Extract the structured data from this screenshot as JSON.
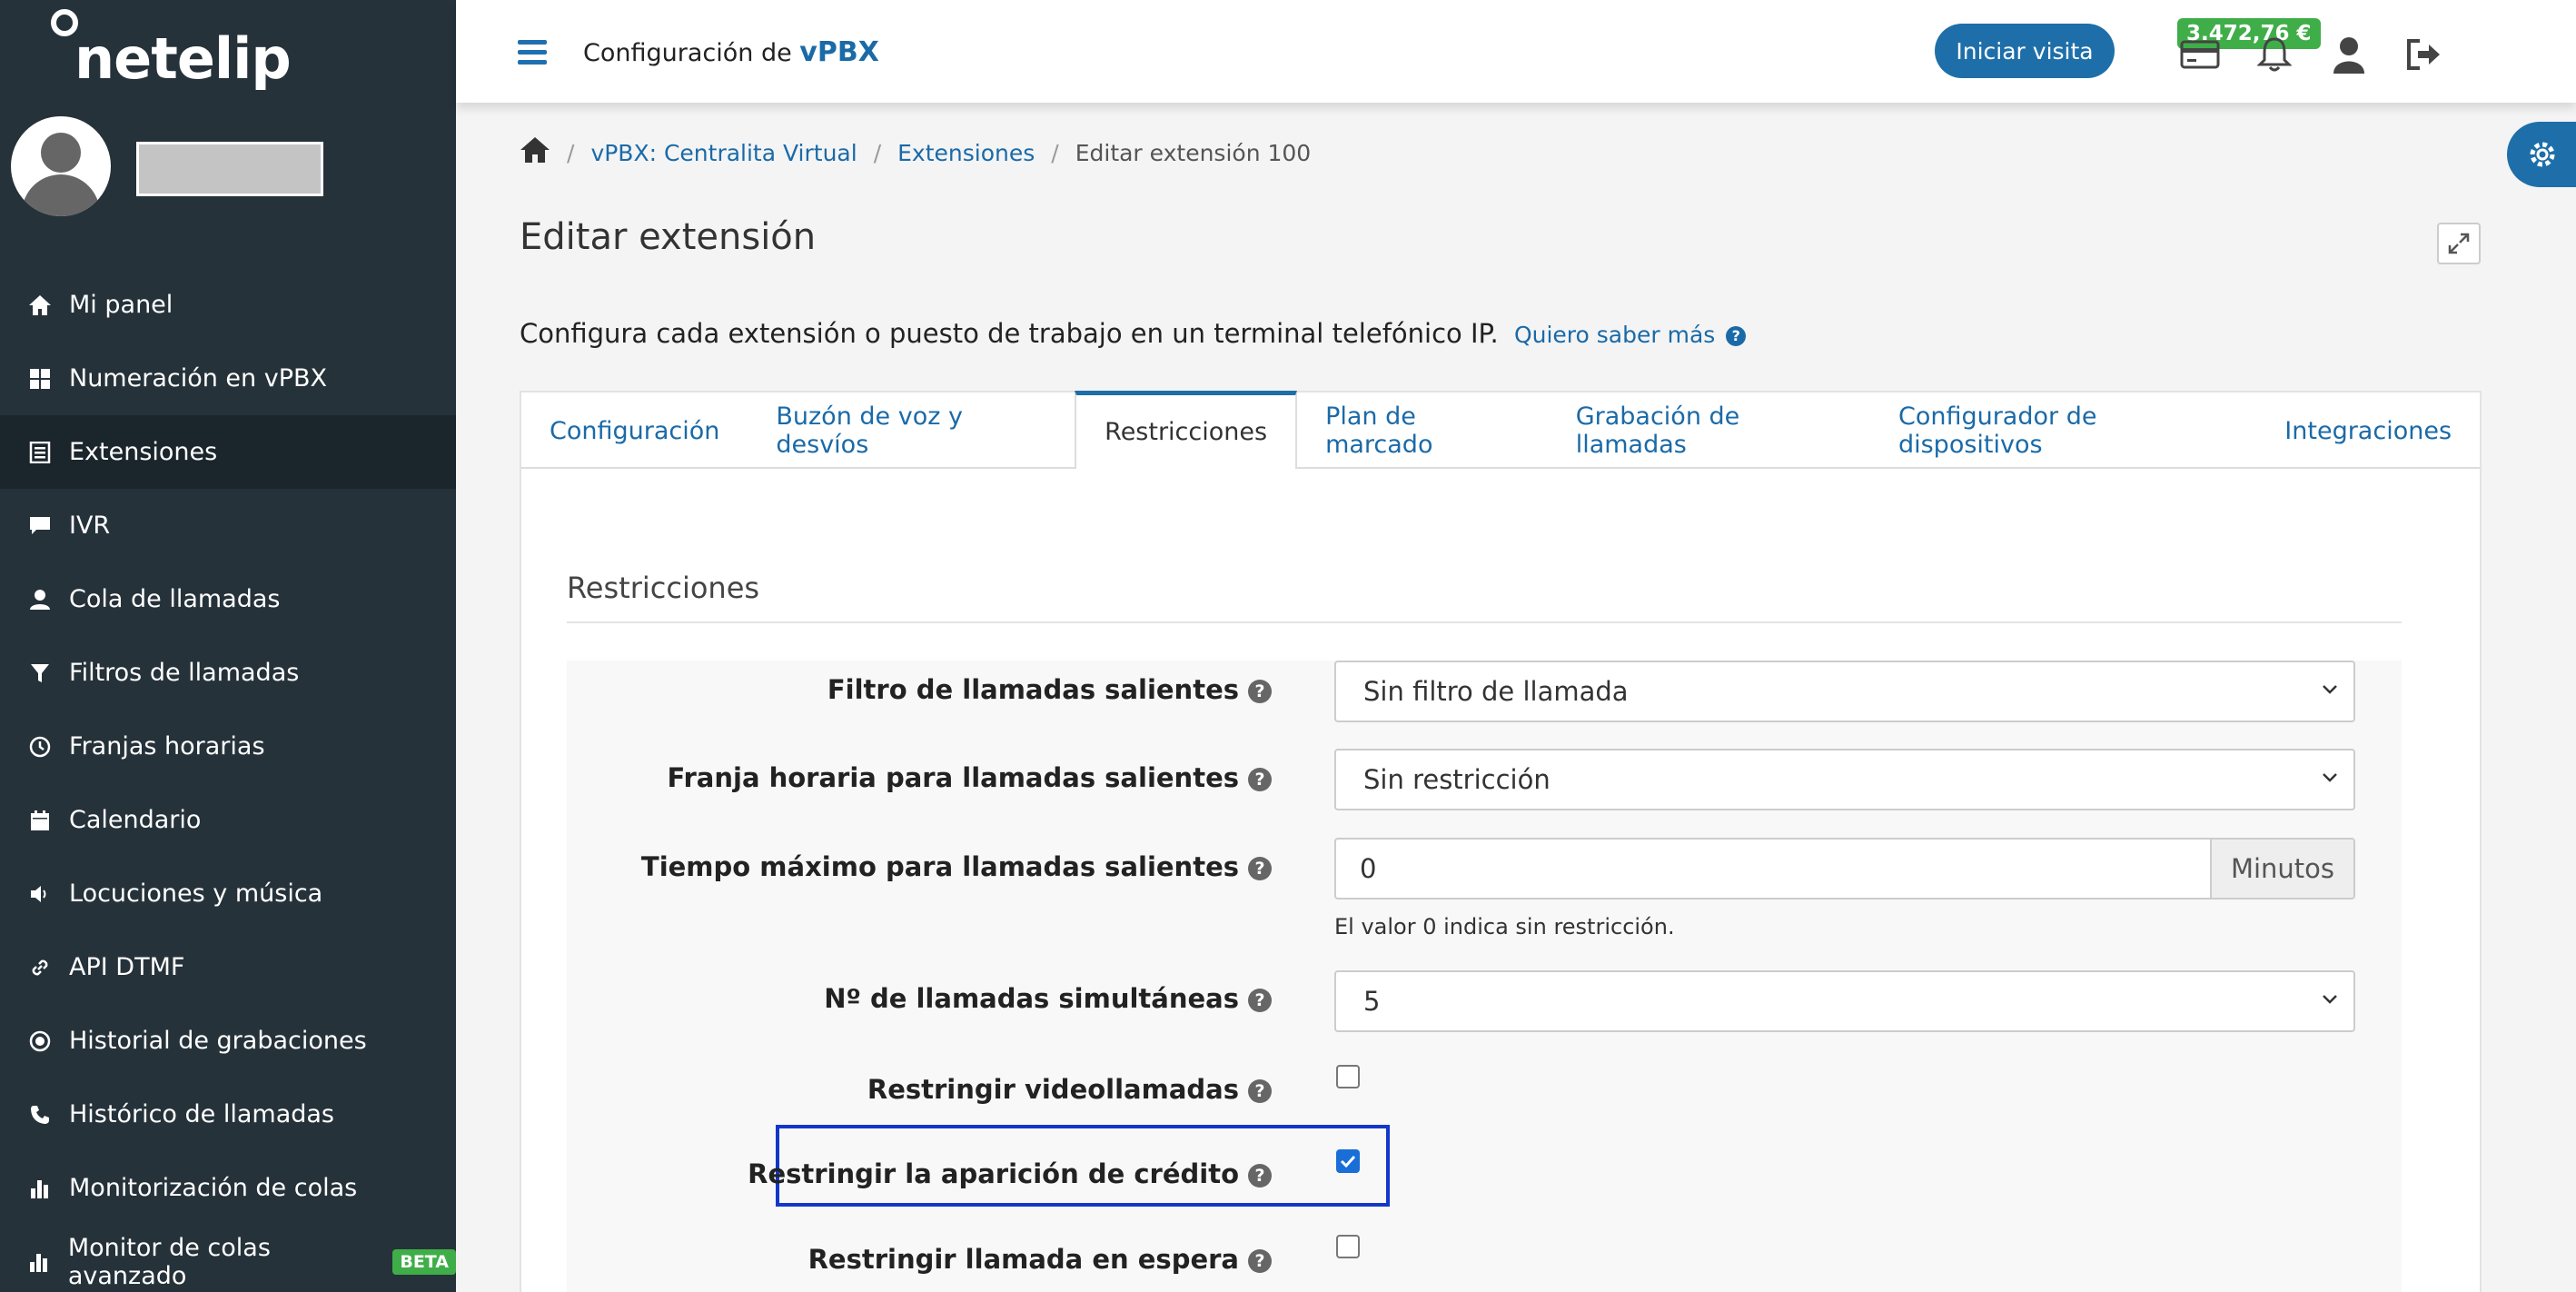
{
  "sidebar": {
    "logo": "netelip",
    "items": [
      {
        "label": "Mi panel",
        "icon": "home-icon"
      },
      {
        "label": "Numeración en vPBX",
        "icon": "grid-icon"
      },
      {
        "label": "Extensiones",
        "icon": "list-icon",
        "active": true
      },
      {
        "label": "IVR",
        "icon": "chat-icon"
      },
      {
        "label": "Cola de llamadas",
        "icon": "user-icon"
      },
      {
        "label": "Filtros de llamadas",
        "icon": "filter-icon"
      },
      {
        "label": "Franjas horarias",
        "icon": "clock-icon"
      },
      {
        "label": "Calendario",
        "icon": "calendar-icon"
      },
      {
        "label": "Locuciones y música",
        "icon": "speaker-icon"
      },
      {
        "label": "API DTMF",
        "icon": "link-icon"
      },
      {
        "label": "Historial de grabaciones",
        "icon": "record-icon"
      },
      {
        "label": "Histórico de llamadas",
        "icon": "phone-icon"
      },
      {
        "label": "Monitorización de colas",
        "icon": "bar-chart-icon"
      },
      {
        "label": "Monitor de colas avanzado",
        "icon": "bar-chart-icon",
        "badge": "BETA"
      }
    ]
  },
  "header": {
    "title_prefix": "Configuración de",
    "title_brand": "vPBX",
    "visit_button": "Iniciar visita",
    "credit": "3.472,76 €"
  },
  "breadcrumb": {
    "items": [
      "vPBX: Centralita Virtual",
      "Extensiones"
    ],
    "current": "Editar extensión 100"
  },
  "page": {
    "title": "Editar extensión",
    "intro": "Configura cada extensión o puesto de trabajo en un terminal telefónico IP.",
    "more_link": "Quiero saber más"
  },
  "tabs": [
    {
      "label": "Configuración"
    },
    {
      "label": "Buzón de voz y desvíos"
    },
    {
      "label": "Restricciones",
      "active": true
    },
    {
      "label": "Plan de marcado"
    },
    {
      "label": "Grabación de llamadas"
    },
    {
      "label": "Configurador de dispositivos"
    },
    {
      "label": "Integraciones"
    }
  ],
  "form": {
    "section_title": "Restricciones",
    "outgoing_filter": {
      "label": "Filtro de llamadas salientes",
      "value": "Sin filtro de llamada"
    },
    "outgoing_timeslot": {
      "label": "Franja horaria para llamadas salientes",
      "value": "Sin restricción"
    },
    "max_time": {
      "label": "Tiempo máximo para llamadas salientes",
      "value": "0",
      "unit": "Minutos",
      "hint": "El valor 0 indica sin restricción."
    },
    "simultaneous": {
      "label": "Nº de llamadas simultáneas",
      "value": "5"
    },
    "restrict_video": {
      "label": "Restringir videollamadas",
      "checked": false
    },
    "restrict_credit": {
      "label": "Restringir la aparición de crédito",
      "checked": true
    },
    "restrict_hold": {
      "label": "Restringir llamada en espera",
      "checked": false
    }
  },
  "colors": {
    "sidebar_bg": "#26323a",
    "accent": "#1e6fa9",
    "badge_green": "#3fae49",
    "highlight_border": "#1237c9"
  }
}
